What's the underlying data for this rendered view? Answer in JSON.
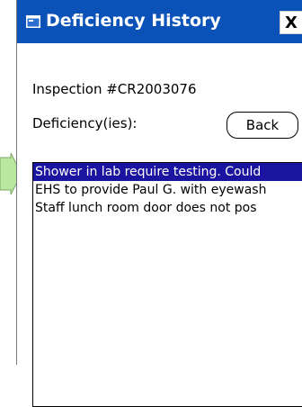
{
  "window": {
    "title": "Deficiency History",
    "close_label": "X",
    "title_bar_color": "#0a52b8"
  },
  "inspection_label": "Inspection #CR2003076",
  "deficiency_label": "Deficiency(ies):",
  "back_label": "Back",
  "deficiencies": [
    {
      "text": "Shower in lab require testing. Could",
      "selected": true
    },
    {
      "text": "EHS to provide Paul G. with eyewash",
      "selected": false
    },
    {
      "text": "Staff lunch room door does not pos",
      "selected": false
    }
  ],
  "selection_color": "#1a14a0",
  "arrow_color": "#b8e8a0"
}
